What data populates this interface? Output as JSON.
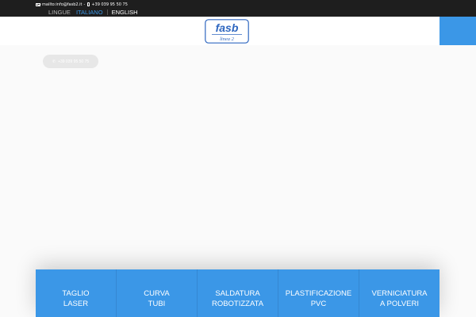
{
  "topbar": {
    "email": "mailto:info@fasb2.it",
    "separator": "-",
    "phone": "+39 039 95 50 75",
    "icons": {
      "email": "envelope-icon",
      "phone": "mobile-phone-icon"
    }
  },
  "languages": {
    "label": "LINGUE",
    "items": [
      "ITALIANO",
      "ENGLISH"
    ],
    "active": "ITALIANO"
  },
  "logo": {
    "name": "fasb",
    "sub": "linea 2"
  },
  "hero": {
    "phone_button": "+39 039 95 50 75"
  },
  "services": [
    {
      "line1": "TAGLIO",
      "line2": "LASER"
    },
    {
      "line1": "CURVA",
      "line2": "TUBI"
    },
    {
      "line1": "SALDATURA",
      "line2": "ROBOTIZZATA"
    },
    {
      "line1": "PLASTIFICAZIONE",
      "line2": "PVC"
    },
    {
      "line1": "VERNICIATURA",
      "line2": "A POLVERI"
    }
  ],
  "colors": {
    "accent": "#3b97e7",
    "topbar": "#1e1e1e",
    "logo_blue": "#2f67c0"
  }
}
